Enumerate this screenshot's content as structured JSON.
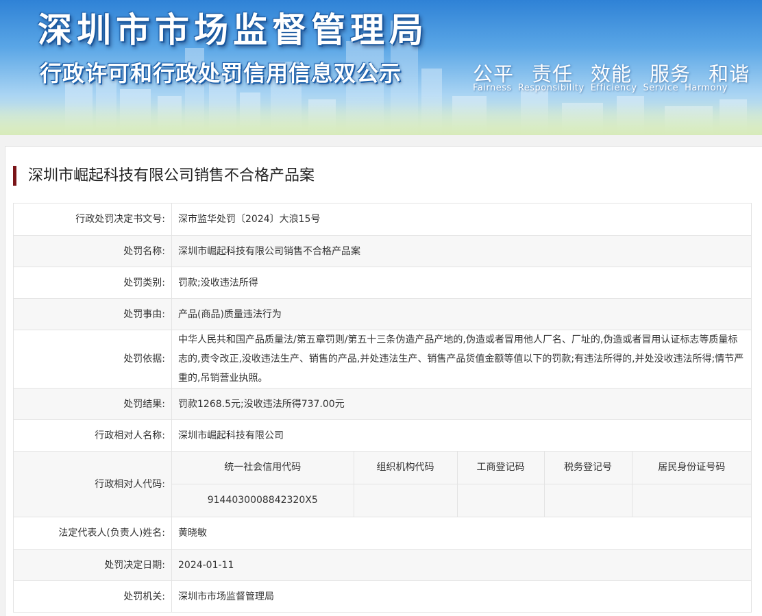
{
  "header": {
    "title": "深圳市市场监督管理局",
    "subtitle": "行政许可和行政处罚信用信息双公示",
    "slogans": [
      "公平",
      "责任",
      "效能",
      "服务",
      "和谐"
    ],
    "slogans_en": [
      "Fairness",
      "Responsibility",
      "Efficiency",
      "Service",
      "Harmony"
    ]
  },
  "case": {
    "title": "深圳市崛起科技有限公司销售不合格产品案",
    "rows": {
      "doc_no": {
        "label": "行政处罚决定书文号:",
        "value": "深市监华处罚〔2024〕大浪15号"
      },
      "name": {
        "label": "处罚名称:",
        "value": "深圳市崛起科技有限公司销售不合格产品案"
      },
      "type": {
        "label": "处罚类别:",
        "value": "罚款;没收违法所得"
      },
      "reason": {
        "label": "处罚事由:",
        "value": "产品(商品)质量违法行为"
      },
      "basis": {
        "label": "处罚依据:",
        "value": "中华人民共和国产品质量法/第五章罚则/第五十三条伪造产品产地的,伪造或者冒用他人厂名、厂址的,伪造或者冒用认证标志等质量标志的,责令改正,没收违法生产、销售的产品,并处违法生产、销售产品货值金额等值以下的罚款;有违法所得的,并处没收违法所得;情节严重的,吊销营业执照。"
      },
      "result": {
        "label": "处罚结果:",
        "value": "罚款1268.5元;没收违法所得737.00元"
      },
      "party_name": {
        "label": "行政相对人名称:",
        "value": "深圳市崛起科技有限公司"
      },
      "party_code": {
        "label": "行政相对人代码:",
        "headers": [
          "统一社会信用代码",
          "组织机构代码",
          "工商登记码",
          "税务登记号",
          "居民身份证号码"
        ],
        "values": [
          "9144030008842320X5",
          "",
          "",
          "",
          ""
        ]
      },
      "legal_rep": {
        "label": "法定代表人(负责人)姓名:",
        "value": "黄晓敏"
      },
      "date": {
        "label": "处罚决定日期:",
        "value": "2024-01-11"
      },
      "authority": {
        "label": "处罚机关:",
        "value": "深圳市市场监督管理局"
      }
    }
  }
}
